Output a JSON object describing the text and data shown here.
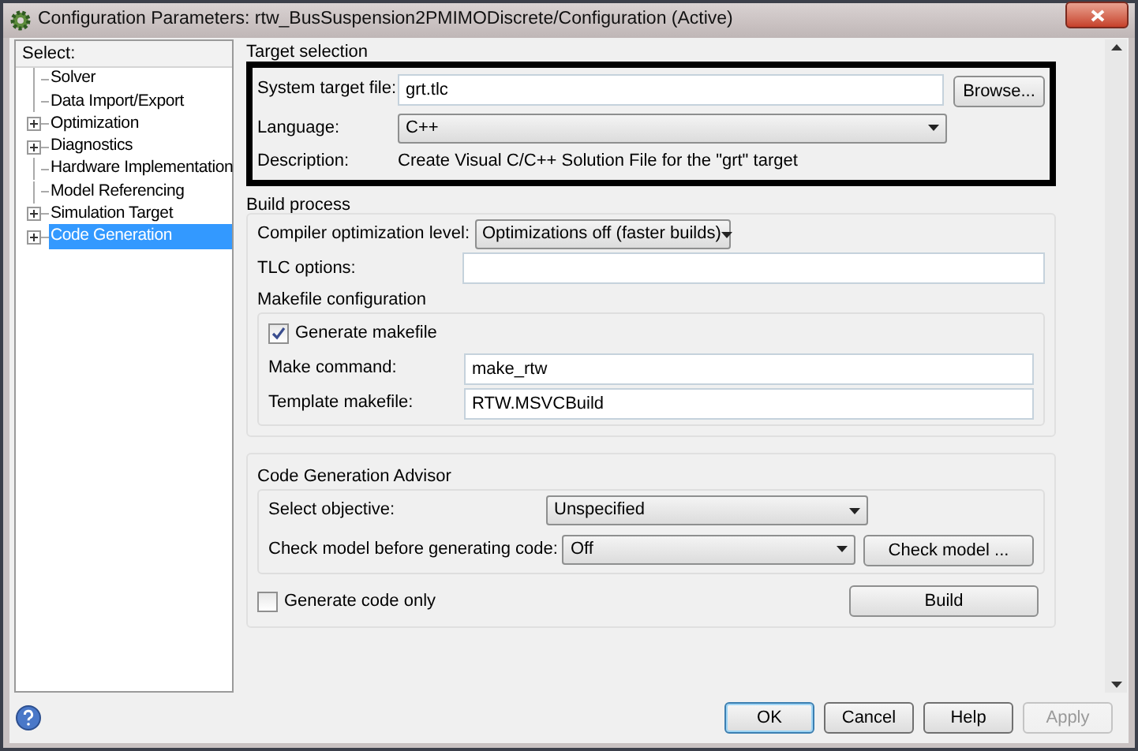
{
  "window": {
    "title": "Configuration Parameters: rtw_BusSuspension2PMIMODiscrete/Configuration (Active)"
  },
  "tree": {
    "label": "Select:",
    "items": [
      {
        "label": "Solver",
        "expandable": false,
        "selected": false
      },
      {
        "label": "Data Import/Export",
        "expandable": false,
        "selected": false
      },
      {
        "label": "Optimization",
        "expandable": true,
        "selected": false
      },
      {
        "label": "Diagnostics",
        "expandable": true,
        "selected": false
      },
      {
        "label": "Hardware Implementation",
        "expandable": false,
        "selected": false
      },
      {
        "label": "Model Referencing",
        "expandable": false,
        "selected": false
      },
      {
        "label": "Simulation Target",
        "expandable": true,
        "selected": false
      },
      {
        "label": "Code Generation",
        "expandable": true,
        "selected": true
      }
    ]
  },
  "target_selection": {
    "title": "Target selection",
    "system_target_file": {
      "label": "System target file:",
      "value": "grt.tlc"
    },
    "browse_button": "Browse...",
    "language": {
      "label": "Language:",
      "value": "C++"
    },
    "description": {
      "label": "Description:",
      "value": "Create Visual C/C++ Solution File for the \"grt\" target"
    }
  },
  "build_process": {
    "title": "Build process",
    "compiler_optimization": {
      "label": "Compiler optimization level:",
      "value": "Optimizations off (faster builds)"
    },
    "tlc_options": {
      "label": "TLC options:"
    },
    "makefile_configuration": {
      "title": "Makefile configuration",
      "generate_makefile": {
        "label": "Generate makefile",
        "checked": true
      },
      "make_command": {
        "label": "Make command:",
        "value": "make_rtw"
      },
      "template_makefile": {
        "label": "Template makefile:",
        "value": "RTW.MSVCBuild"
      }
    }
  },
  "code_generation_advisor": {
    "title": "Code Generation Advisor",
    "select_objective": {
      "label": "Select objective:",
      "value": "Unspecified"
    },
    "check_model": {
      "label": "Check model before generating code:",
      "value": "Off"
    },
    "check_model_button": "Check model ..."
  },
  "generate_code_only": {
    "label": "Generate code only",
    "checked": false
  },
  "build_button": "Build",
  "buttons": [
    {
      "label": "OK",
      "default": true,
      "disabled": false
    },
    {
      "label": "Cancel",
      "default": false,
      "disabled": false
    },
    {
      "label": "Help",
      "default": false,
      "disabled": false
    },
    {
      "label": "Apply",
      "default": false,
      "disabled": true
    }
  ]
}
